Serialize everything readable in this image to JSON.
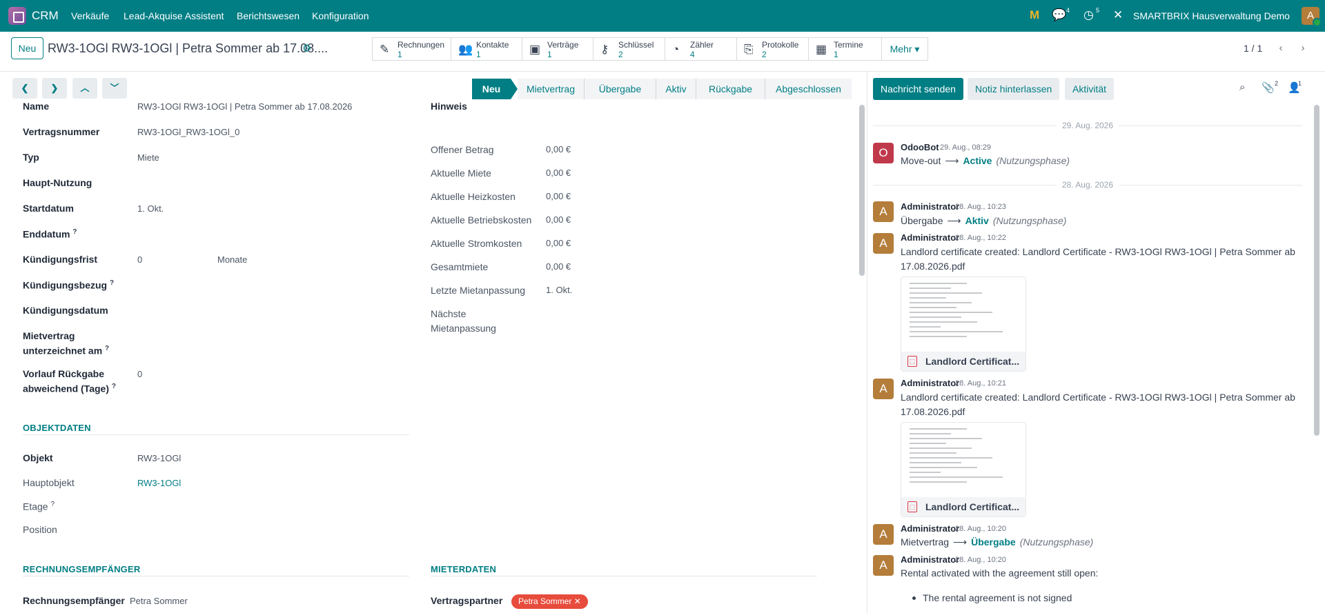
{
  "navbar": {
    "app_name": "CRM",
    "menu": [
      "Verkäufe",
      "Lead-Akquise Assistent",
      "Berichtswesen",
      "Konfiguration"
    ],
    "messages_count": "4",
    "activities_count": "5",
    "company": "SMARTBRIX Hausverwaltung Demo",
    "avatar_letter": "A"
  },
  "control_panel": {
    "new_button": "Neu",
    "record_title": "RW3-1OGl RW3-1OGl | Petra Sommer ab 17.08....",
    "smart_buttons": [
      {
        "label": "Rechnungen",
        "count": "1",
        "icon": "invoice-icon"
      },
      {
        "label": "Kontakte",
        "count": "1",
        "icon": "contacts-icon"
      },
      {
        "label": "Verträge",
        "count": "1",
        "icon": "money-icon"
      },
      {
        "label": "Schlüssel",
        "count": "2",
        "icon": "key-icon"
      },
      {
        "label": "Zähler",
        "count": "4",
        "icon": "gauge-icon"
      },
      {
        "label": "Protokolle",
        "count": "2",
        "icon": "documents-icon"
      },
      {
        "label": "Termine",
        "count": "1",
        "icon": "calendar-icon"
      }
    ],
    "more_button": "Mehr",
    "pager": "1 / 1"
  },
  "statusbar": {
    "stages": [
      "Neu",
      "Mietvertrag",
      "Übergabe",
      "Aktiv",
      "Rückgabe",
      "Abgeschlossen"
    ],
    "active_stage": "Neu"
  },
  "form": {
    "left_fields": [
      {
        "label": "Name",
        "value": "RW3-1OGl RW3-1OGl | Petra Sommer ab 17.08.2026"
      },
      {
        "label": "Vertragsnummer",
        "value": "RW3-1OGl_RW3-1OGl_0"
      },
      {
        "label": "Typ",
        "value": "Miete"
      },
      {
        "label": "Haupt-Nutzung",
        "value": ""
      },
      {
        "label": "Startdatum",
        "value": "1. Okt."
      },
      {
        "label": "Enddatum",
        "value": ""
      },
      {
        "label": "Kündigungsfrist",
        "value": "0",
        "unit": "Monate"
      },
      {
        "label": "Kündigungsbezug",
        "value": ""
      },
      {
        "label": "Kündigungsdatum",
        "value": ""
      },
      {
        "label": "Mietvertrag unterzeichnet am",
        "line1": "Mietvertrag",
        "line2": "unterzeichnet am",
        "value": ""
      },
      {
        "label": "Vorlauf Rückgabe abweichend (Tage)",
        "line1": "Vorlauf Rückgabe",
        "line2": "abweichend (Tage)",
        "value": "0"
      }
    ],
    "right_fields": [
      {
        "label": "Hinweis",
        "value": ""
      },
      {
        "label": "Offener Betrag",
        "value": "0,00 €"
      },
      {
        "label": "Aktuelle Miete",
        "value": "0,00 €"
      },
      {
        "label": "Aktuelle Heizkosten",
        "value": "0,00 €"
      },
      {
        "label": "Aktuelle Betriebskosten",
        "value": "0,00 €"
      },
      {
        "label": "Aktuelle Stromkosten",
        "value": "0,00 €"
      },
      {
        "label": "Gesamtmiete",
        "value": "0,00 €"
      },
      {
        "label": "Letzte Mietanpassung",
        "value": "1. Okt."
      },
      {
        "label": "Nächste Mietanpassung",
        "line1": "Nächste",
        "line2": "Mietanpassung",
        "value": ""
      }
    ],
    "objektdaten": {
      "title": "OBJEKTDATEN",
      "fields": [
        {
          "label": "Objekt",
          "value": "RW3-1OGl"
        },
        {
          "label": "Hauptobjekt",
          "value": "RW3-1OGl"
        },
        {
          "label": "Etage",
          "value": ""
        },
        {
          "label": "Position",
          "value": ""
        }
      ]
    },
    "rechnung": {
      "title": "RECHNUNGSEMPFÄNGER",
      "label": "Rechnungsempfänger",
      "value": "Petra Sommer"
    },
    "mieter": {
      "title": "MIETERDATEN",
      "label": "Vertragspartner",
      "tag": "Petra Sommer"
    }
  },
  "chatter": {
    "send_message": "Nachricht senden",
    "log_note": "Notiz hinterlassen",
    "activity": "Aktivität",
    "attachments_count": "2",
    "followers_count": "1",
    "date_separators": [
      "29. Aug. 2026",
      "28. Aug. 2026"
    ],
    "messages": [
      {
        "author": "OdooBot",
        "avatar": "O",
        "avatar_color": "#c0394b",
        "time": "29. Aug., 08:29",
        "old": "Move-out",
        "new": "Active",
        "field": "(Nutzungsphase)"
      },
      {
        "author": "Administrator",
        "avatar": "A",
        "avatar_color": "#b47d3a",
        "time": "28. Aug., 10:23",
        "old": "Übergabe",
        "new": "Aktiv",
        "field": "(Nutzungsphase)"
      },
      {
        "author": "Administrator",
        "avatar": "A",
        "avatar_color": "#b47d3a",
        "time": "28. Aug., 10:22",
        "line1": "Landlord certificate created: Landlord Certificate - RW3-1OGl RW3-1OGl | Petra Sommer ab",
        "line2": "17.08.2026.pdf",
        "attachment": "Landlord Certificat..."
      },
      {
        "author": "Administrator",
        "avatar": "A",
        "avatar_color": "#b47d3a",
        "time": "28. Aug., 10:21",
        "line1": "Landlord certificate created: Landlord Certificate - RW3-1OGl RW3-1OGl | Petra Sommer ab",
        "line2": "17.08.2026.pdf",
        "attachment": "Landlord Certificat..."
      },
      {
        "author": "Administrator",
        "avatar": "A",
        "avatar_color": "#b47d3a",
        "time": "28. Aug., 10:20",
        "old": "Mietvertrag",
        "new": "Übergabe",
        "field": "(Nutzungsphase)"
      },
      {
        "author": "Administrator",
        "avatar": "A",
        "avatar_color": "#b47d3a",
        "time": "28. Aug., 10:20",
        "line1": "Rental activated with the agreement still open:",
        "bullet": "The rental agreement is not signed"
      }
    ]
  }
}
